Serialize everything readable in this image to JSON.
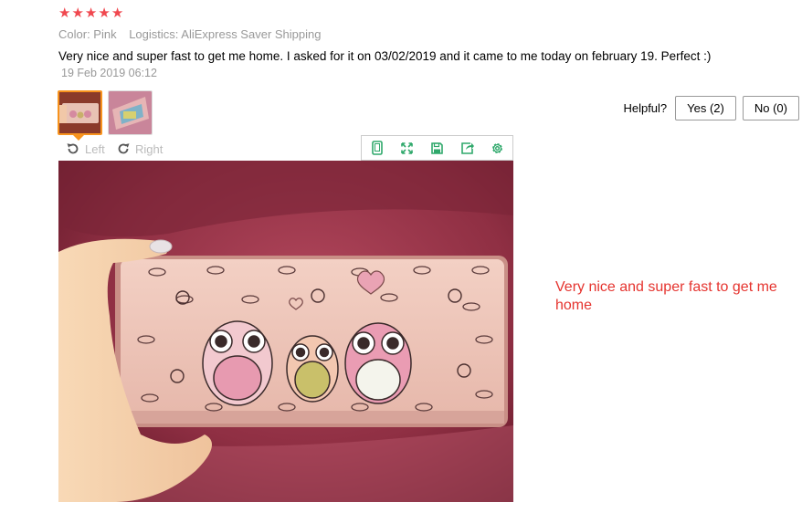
{
  "review": {
    "rating": 5,
    "color": "Color: Pink",
    "logistics": "Logistics: AliExpress Saver Shipping",
    "text": "Very nice and super fast to get me home. I asked for it on 03/02/2019 and it came to me today on february 19. Perfect :)",
    "date": "19 Feb 2019 06:12"
  },
  "helpful": {
    "label": "Helpful?",
    "yes": "Yes (2)",
    "no": "No (0)"
  },
  "viewer": {
    "rotate_left": "Left",
    "rotate_right": "Right",
    "tools": [
      "phone-icon",
      "expand-icon",
      "save-icon",
      "share-icon",
      "settings-icon"
    ]
  },
  "caption": "Very nice and super fast to get me home",
  "colors": {
    "star": "#f0484f",
    "accent": "#f7931e",
    "tool_icon": "#2fa86b",
    "caption": "#e5342f"
  }
}
